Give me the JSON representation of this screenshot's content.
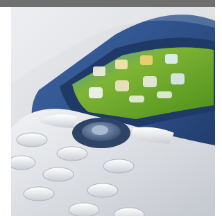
{
  "image": {
    "subject_icon": "mobile-phone-icon",
    "colors": {
      "frame_bar": "#6f6f6f",
      "background": "#d9dbdd",
      "phone_body": "#2f4f86",
      "screen": "#6fae2a",
      "keypad": "#e6e8ec"
    }
  }
}
